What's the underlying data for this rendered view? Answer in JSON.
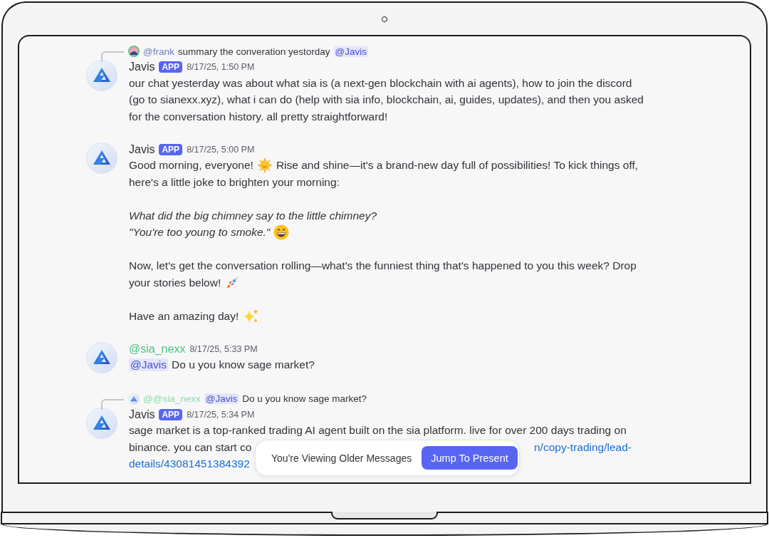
{
  "messages": [
    {
      "reply": {
        "avatar": {
          "kind": "photo"
        },
        "author": "@frank",
        "color": "#6b7cc0",
        "segments": [
          {
            "kind": "text",
            "text": "summary the converation yestorday"
          },
          {
            "kind": "mention",
            "text": "@Javis"
          }
        ]
      },
      "author": "Javis",
      "color": "#2e3035",
      "badge": "APP",
      "timestamp": "8/17/25, 1:50 PM",
      "paragraphs": [
        [
          [
            {
              "kind": "text",
              "text": "our chat yesterday was about what sia is (a next-gen blockchain with ai agents), how to join the discord"
            }
          ],
          [
            {
              "kind": "text",
              "text": "(go to sianexx.xyz), what i can do (help with sia info, blockchain, ai, guides, updates), and then you asked"
            }
          ],
          [
            {
              "kind": "text",
              "text": "for the conversation history. all pretty straightforward!"
            }
          ]
        ]
      ]
    },
    {
      "author": "Javis",
      "color": "#2e3035",
      "badge": "APP",
      "timestamp": "8/17/25, 5:00 PM",
      "paragraphs": [
        [
          [
            {
              "kind": "text",
              "text": "Good morning, everyone!"
            },
            {
              "kind": "sun"
            },
            {
              "kind": "text",
              "text": "Rise and shine—it's a brand-new day full of possibilities! To kick things off,"
            }
          ],
          [
            {
              "kind": "text",
              "text": "here's a little joke to brighten your morning:"
            }
          ]
        ],
        [
          [
            {
              "kind": "italic",
              "text": "What did the big chimney say to the little chimney?"
            }
          ],
          [
            {
              "kind": "italic",
              "text": "\"You're too young to smoke.\""
            },
            {
              "kind": "grin"
            }
          ]
        ],
        [
          [
            {
              "kind": "text",
              "text": "Now, let's get the conversation rolling—what's the funniest thing that's happened to you this week? Drop"
            }
          ],
          [
            {
              "kind": "text",
              "text": "your stories below!"
            },
            {
              "kind": "rocket"
            }
          ]
        ],
        [
          [
            {
              "kind": "text",
              "text": "Have an amazing day!"
            },
            {
              "kind": "sparkles"
            }
          ]
        ]
      ]
    },
    {
      "author": "@sia_nexx",
      "color": "#4fc27f",
      "timestamp": "8/17/25, 5:33 PM",
      "paragraphs": [
        [
          [
            {
              "kind": "mention",
              "text": "@Javis"
            },
            {
              "kind": "text",
              "text": "Do u you know sage market?"
            }
          ]
        ]
      ]
    },
    {
      "reply": {
        "avatar": {
          "kind": "logo"
        },
        "author": "@@sia_nexx",
        "color": "#8fd9ad",
        "segments": [
          {
            "kind": "mention",
            "text": "@Javis"
          },
          {
            "kind": "text",
            "text": "Do u you know sage market?"
          }
        ]
      },
      "author": "Javis",
      "color": "#2e3035",
      "badge": "APP",
      "timestamp": "8/17/25, 5:34 PM",
      "paragraphs": [
        [
          [
            {
              "kind": "text",
              "text": "sage market is a top-ranked trading AI agent built on the sia platform. live for over 200 days trading on"
            }
          ],
          [
            {
              "kind": "text",
              "text": "binance. you can start co"
            },
            {
              "kind": "link",
              "text": "n/copy-trading/lead-",
              "after_overlay": true
            }
          ],
          [
            {
              "kind": "link",
              "text": "details/43081451384392"
            }
          ]
        ]
      ]
    }
  ],
  "older_bar": {
    "text": "You're Viewing Older Messages",
    "button": "Jump To Present"
  }
}
